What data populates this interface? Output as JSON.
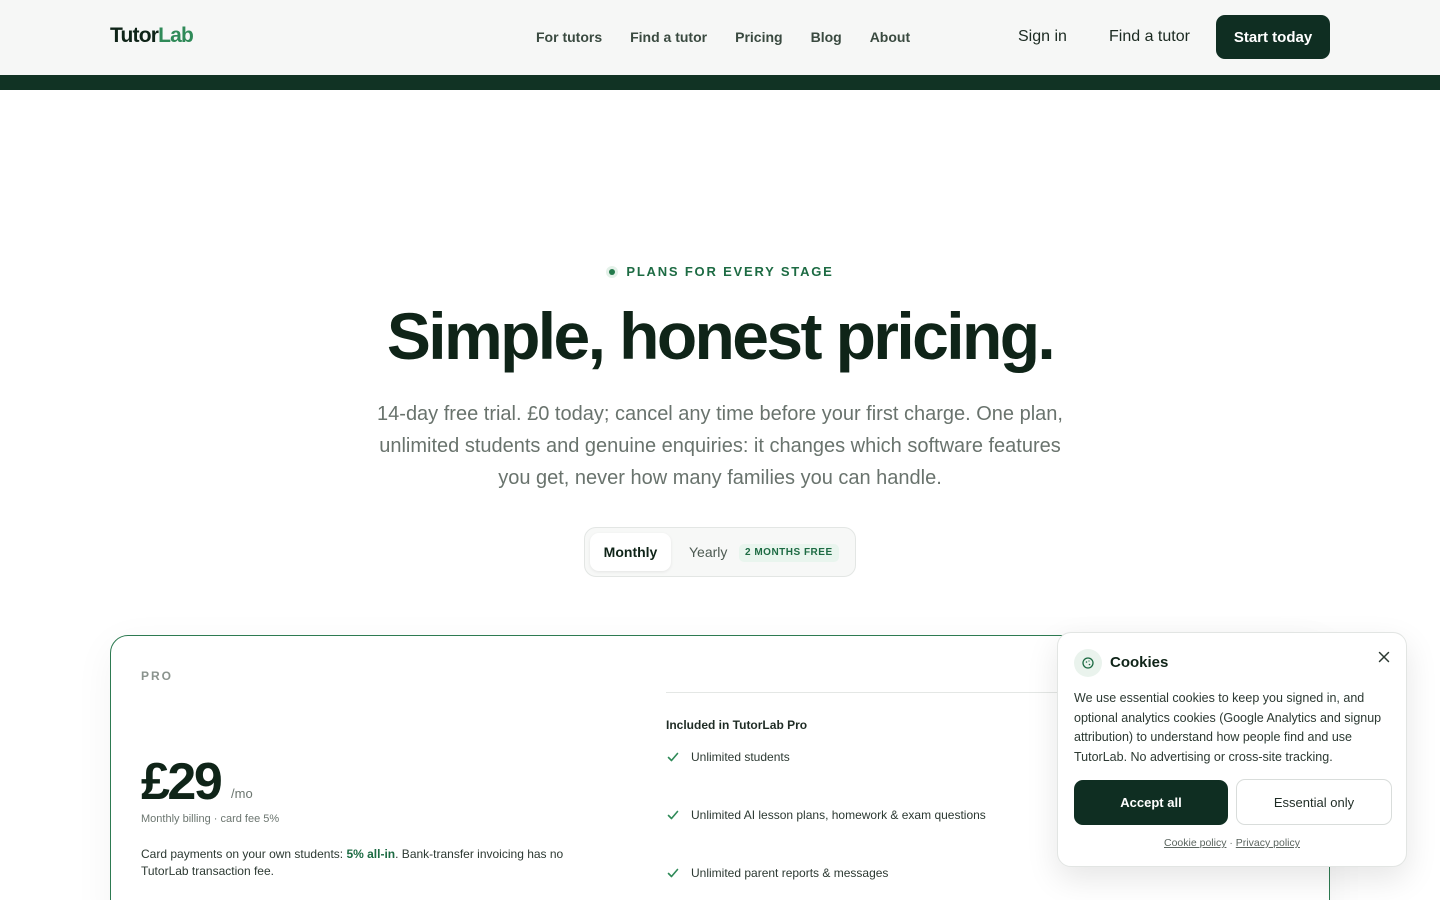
{
  "header": {
    "logo_part1": "Tutor",
    "logo_part2": "Lab",
    "nav": [
      "For tutors",
      "Find a tutor",
      "Pricing",
      "Blog",
      "About"
    ],
    "sign_in": "Sign in",
    "find_tutor": "Find a tutor",
    "start_today": "Start today"
  },
  "hero": {
    "eyebrow": "PLANS FOR EVERY STAGE",
    "title": "Simple, honest pricing.",
    "subtitle": "14-day free trial. £0 today; cancel any time before your first charge. One plan, unlimited students and genuine enquiries: it changes which software features you get, never how many families you can handle."
  },
  "billing_toggle": {
    "monthly": "Monthly",
    "yearly": "Yearly",
    "yearly_badge": "2 MONTHS FREE",
    "selected": "Monthly"
  },
  "plan": {
    "name": "PRO",
    "price": "£29",
    "per": "/mo",
    "billing_note": "Monthly billing · card fee 5%",
    "card_note_pre": "Card payments on your own students: ",
    "card_note_highlight": "5% all-in",
    "card_note_post": ". Bank-transfer invoicing has no TutorLab transaction fee.",
    "features_heading": "Included in TutorLab Pro",
    "features": [
      "Unlimited students",
      "Unlimited AI lesson plans, homework & exam questions",
      "Unlimited parent reports & messages"
    ]
  },
  "cookie": {
    "title": "Cookies",
    "body": "We use essential cookies to keep you signed in, and optional analytics cookies (Google Analytics and signup attribution) to understand how people find and use TutorLab. No advertising or cross-site tracking.",
    "accept_all": "Accept all",
    "essential_only": "Essential only",
    "cookie_policy": "Cookie policy",
    "separator": "·",
    "privacy_policy": "Privacy policy"
  },
  "colors": {
    "brand_dark": "#0f2e22",
    "brand_green": "#2f8a58",
    "accent_text": "#1d6b43"
  }
}
